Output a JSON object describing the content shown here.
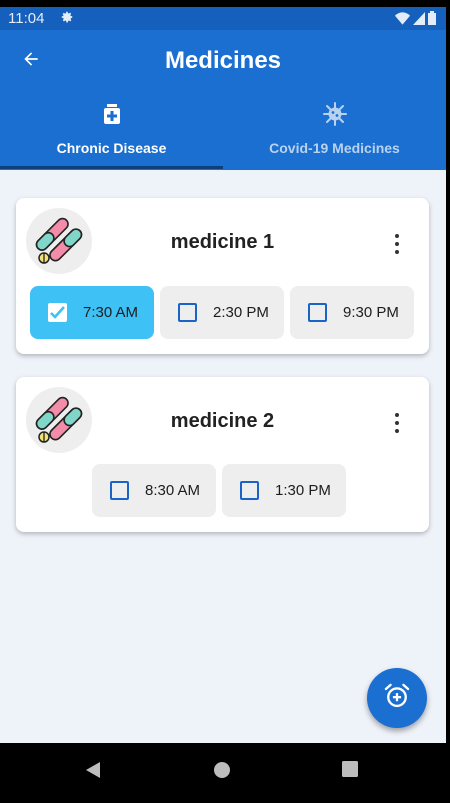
{
  "status_bar": {
    "time": "11:04"
  },
  "app_bar": {
    "title": "Medicines"
  },
  "tabs": [
    {
      "label": "Chronic Disease",
      "icon": "medical-box-icon",
      "selected": true
    },
    {
      "label": "Covid-19 Medicines",
      "icon": "virus-icon",
      "selected": false
    }
  ],
  "medicines": [
    {
      "name": "medicine 1",
      "times": [
        {
          "label": "7:30 AM",
          "checked": true
        },
        {
          "label": "2:30 PM",
          "checked": false
        },
        {
          "label": "9:30 PM",
          "checked": false
        }
      ]
    },
    {
      "name": "medicine 2",
      "times": [
        {
          "label": "8:30 AM",
          "checked": false
        },
        {
          "label": "1:30 PM",
          "checked": false
        }
      ]
    }
  ],
  "colors": {
    "primary": "#1a6fd0",
    "status_bar": "#1560bd",
    "checked_chip": "#3ec1f5",
    "chip": "#eeeeee",
    "background": "#eef2f9"
  }
}
